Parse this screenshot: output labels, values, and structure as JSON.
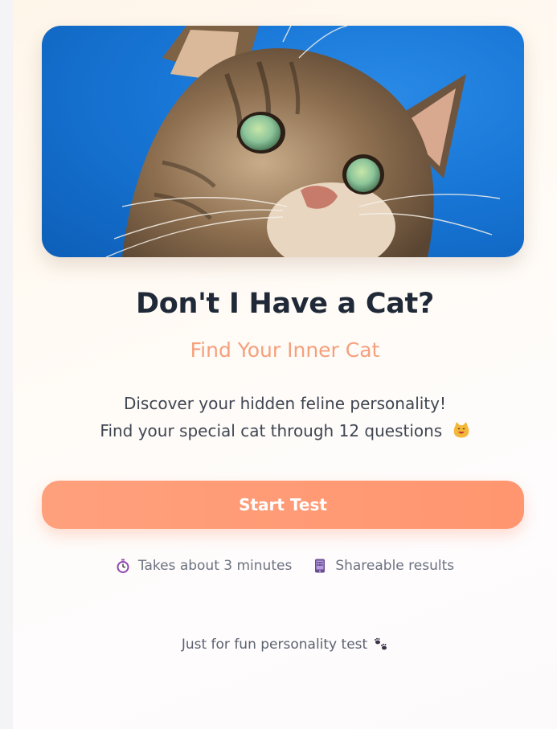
{
  "hero": {
    "image_alt": "tabby cat looking up against a blue sky"
  },
  "title": "Don't I Have a Cat?",
  "subtitle": "Find Your Inner Cat",
  "description": {
    "line1": "Discover your hidden feline personality!",
    "line2": "Find your special cat through 12 questions",
    "line2_emoji": "smiling-cat-icon"
  },
  "start_button": {
    "label": "Start Test"
  },
  "meta": {
    "duration": {
      "icon": "stopwatch-icon",
      "text": "Takes about 3 minutes"
    },
    "share": {
      "icon": "phone-icon",
      "text": "Shareable results"
    }
  },
  "footer": {
    "text": "Just for fun personality test",
    "icon": "paw-prints-icon"
  },
  "colors": {
    "title": "#1f2937",
    "subtitle": "#f5a07c",
    "button": "#ff9a76",
    "sky": "#1876d6"
  }
}
